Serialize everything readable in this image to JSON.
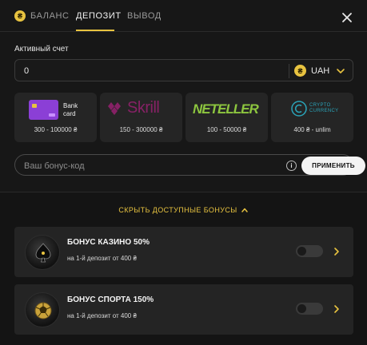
{
  "tabs": [
    {
      "label": "БАЛАНС",
      "active": false
    },
    {
      "label": "ДЕПОЗИТ",
      "active": true
    },
    {
      "label": "ВЫВОД",
      "active": false
    }
  ],
  "coin_symbol": "₴",
  "account": {
    "label": "Активный счет",
    "value": "0",
    "currency_symbol": "₴",
    "currency_code": "UAH"
  },
  "methods": [
    {
      "name": "Bank card",
      "logo_line1": "Bank",
      "logo_line2": "card",
      "range": "300 - 100000 ₴"
    },
    {
      "name": "Skrill",
      "logo": "Skrill",
      "range": "150 - 300000 ₴"
    },
    {
      "name": "Neteller",
      "logo": "NETELLER",
      "range": "100 - 50000 ₴"
    },
    {
      "name": "Crypto currency",
      "logo_line1": "CRYPTO",
      "logo_line2": "CURRENCY",
      "range": "400 ₴ - unlim"
    }
  ],
  "bonus_code": {
    "placeholder": "Ваш бонус-код",
    "info": "i",
    "apply_label": "ПРИМЕНИТЬ"
  },
  "toggle_label": "СКРЫТЬ ДОСТУПНЫЕ БОНУСЫ",
  "bonuses": [
    {
      "title": "БОНУС КАЗИНО 50%",
      "subtitle": "на 1-й депозит от 400 ₴",
      "enabled": false
    },
    {
      "title": "БОНУС СПОРТА 150%",
      "subtitle": "на 1-й депозит от 400 ₴",
      "enabled": false
    }
  ],
  "colors": {
    "accent": "#e8c340",
    "skrill": "#862165",
    "neteller": "#8dc63f",
    "bank_card": "#8b3fd6",
    "crypto": "#2aa3b8"
  }
}
